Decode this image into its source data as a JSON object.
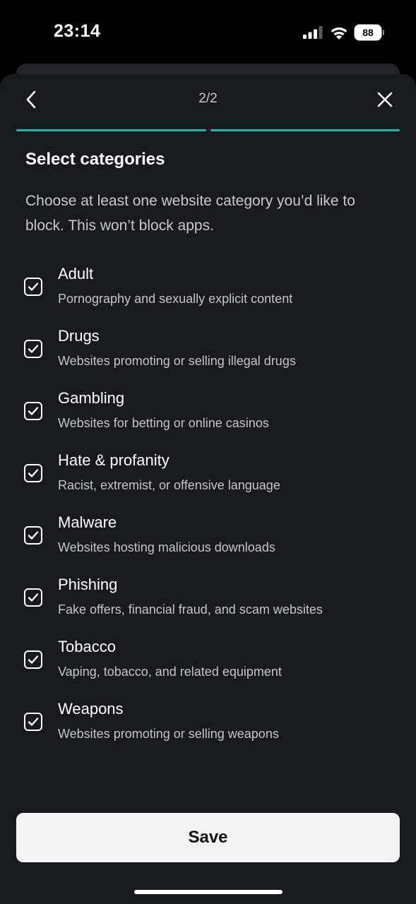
{
  "status_bar": {
    "time": "23:14",
    "battery": "88",
    "icons": [
      "signal-icon",
      "wifi-icon",
      "battery-icon"
    ]
  },
  "header": {
    "step": "2/2",
    "back_icon": "chevron-left-icon",
    "close_icon": "close-icon"
  },
  "progress": {
    "current_step": 2,
    "total_steps": 2,
    "accent_color": "#1fb5a9"
  },
  "title": "Select categories",
  "description": "Choose at least one website category you’d like to block. This won’t block apps.",
  "categories": [
    {
      "name": "Adult",
      "description": "Pornography and sexually explicit content",
      "checked": true
    },
    {
      "name": "Drugs",
      "description": "Websites promoting or selling illegal drugs",
      "checked": true
    },
    {
      "name": "Gambling",
      "description": "Websites for betting or online casinos",
      "checked": true
    },
    {
      "name": "Hate & profanity",
      "description": "Racist, extremist, or offensive language",
      "checked": true
    },
    {
      "name": "Malware",
      "description": "Websites hosting malicious downloads",
      "checked": true
    },
    {
      "name": "Phishing",
      "description": "Fake offers, financial fraud, and scam websites",
      "checked": true
    },
    {
      "name": "Tobacco",
      "description": "Vaping, tobacco, and related equipment",
      "checked": true
    },
    {
      "name": "Weapons",
      "description": "Websites promoting or selling weapons",
      "checked": true
    }
  ],
  "save_label": "Save",
  "colors": {
    "background": "#000000",
    "sheet": "#171b1e",
    "accent": "#1fb5a9",
    "button": "#f1f2f2"
  }
}
